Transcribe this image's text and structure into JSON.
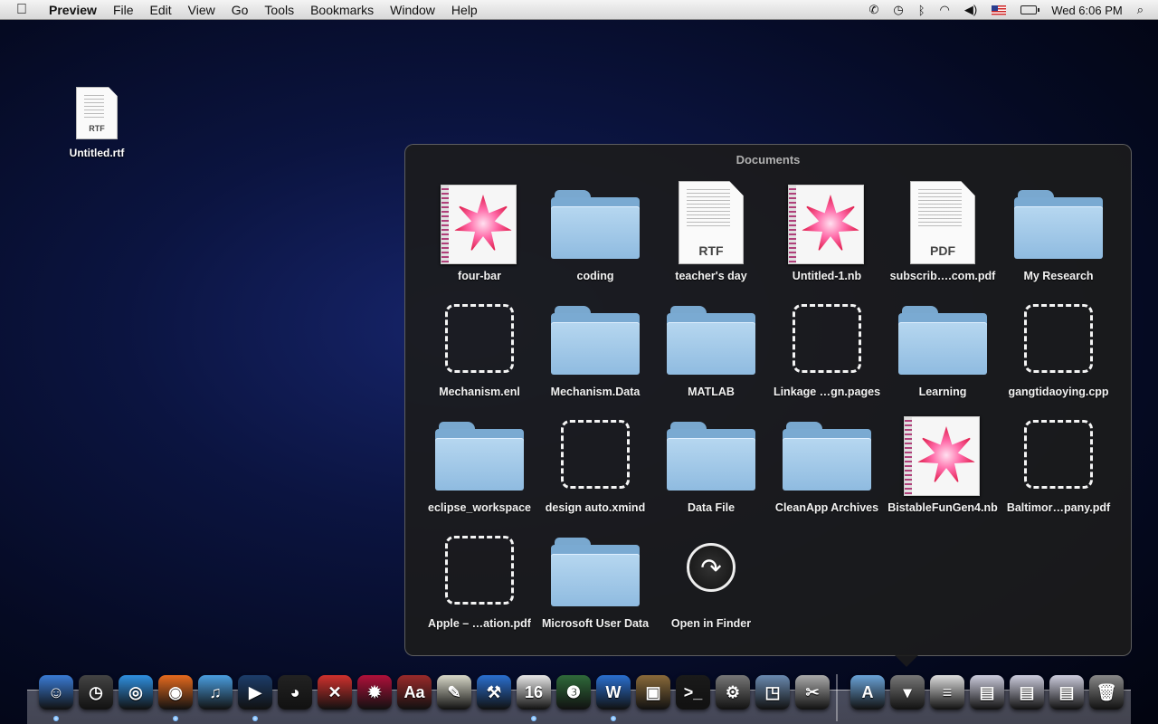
{
  "menubar": {
    "app_name": "Preview",
    "menus": [
      "File",
      "Edit",
      "View",
      "Go",
      "Tools",
      "Bookmarks",
      "Window",
      "Help"
    ],
    "clock": "Wed 6:06 PM"
  },
  "desktop": {
    "icons": [
      {
        "label": "Untitled.rtf",
        "ext": "RTF"
      }
    ]
  },
  "stack": {
    "title": "Documents",
    "items": [
      {
        "label": "four-bar",
        "kind": "notebook"
      },
      {
        "label": "coding",
        "kind": "folder"
      },
      {
        "label": "teacher's day",
        "kind": "document",
        "ext": "RTF"
      },
      {
        "label": "Untitled-1.nb",
        "kind": "notebook"
      },
      {
        "label": "subscrib….com.pdf",
        "kind": "document",
        "ext": "PDF"
      },
      {
        "label": "My Research",
        "kind": "folder"
      },
      {
        "label": "Mechanism.enl",
        "kind": "placeholder"
      },
      {
        "label": "Mechanism.Data",
        "kind": "folder"
      },
      {
        "label": "MATLAB",
        "kind": "folder"
      },
      {
        "label": "Linkage …gn.pages",
        "kind": "placeholder"
      },
      {
        "label": "Learning",
        "kind": "folder"
      },
      {
        "label": "gangtidaoying.cpp",
        "kind": "placeholder"
      },
      {
        "label": "eclipse_workspace",
        "kind": "folder"
      },
      {
        "label": "design auto.xmind",
        "kind": "placeholder"
      },
      {
        "label": "Data File",
        "kind": "folder"
      },
      {
        "label": "CleanApp Archives",
        "kind": "folder"
      },
      {
        "label": "BistableFunGen4.nb",
        "kind": "notebook"
      },
      {
        "label": "Baltimor…pany.pdf",
        "kind": "placeholder"
      },
      {
        "label": "Apple – …ation.pdf",
        "kind": "placeholder"
      },
      {
        "label": "Microsoft User Data",
        "kind": "folder"
      },
      {
        "label": "Open in Finder",
        "kind": "open-finder"
      }
    ]
  },
  "dock": {
    "apps": [
      {
        "name": "finder-icon",
        "glyph": "☺",
        "color": "#3a7bd5"
      },
      {
        "name": "dashboard-icon",
        "glyph": "◷",
        "color": "#444"
      },
      {
        "name": "safari-icon",
        "glyph": "◎",
        "color": "#2f8fe0"
      },
      {
        "name": "firefox-icon",
        "glyph": "◉",
        "color": "#e66a1e"
      },
      {
        "name": "itunes-icon",
        "glyph": "♫",
        "color": "#4a9ee0"
      },
      {
        "name": "quicktime-icon",
        "glyph": "▶",
        "color": "#1c3d6a"
      },
      {
        "name": "qq-icon",
        "glyph": "◕",
        "color": "#222"
      },
      {
        "name": "xmind-icon",
        "glyph": "✕",
        "color": "#d0312d"
      },
      {
        "name": "mathematica-icon",
        "glyph": "✹",
        "color": "#b0103a"
      },
      {
        "name": "dictionary-icon",
        "glyph": "Aa",
        "color": "#9a2a2a"
      },
      {
        "name": "textedit-icon",
        "glyph": "✎",
        "color": "#d8d8c8"
      },
      {
        "name": "xcode-icon",
        "glyph": "⚒",
        "color": "#2a6fd0"
      },
      {
        "name": "ical-icon",
        "glyph": "16",
        "color": "#e8e8e8"
      },
      {
        "name": "matlab-icon",
        "glyph": "❸",
        "color": "#2f6a3a"
      },
      {
        "name": "word-icon",
        "glyph": "W",
        "color": "#2a6fd0"
      },
      {
        "name": "iphoto-icon",
        "glyph": "▣",
        "color": "#8a6a3a"
      },
      {
        "name": "terminal-icon",
        "glyph": ">_",
        "color": "#1a1a1a"
      },
      {
        "name": "system-preferences-icon",
        "glyph": "⚙",
        "color": "#777"
      },
      {
        "name": "preview-icon",
        "glyph": "◳",
        "color": "#6a8ab0"
      },
      {
        "name": "grab-icon",
        "glyph": "✂",
        "color": "#aaa"
      }
    ],
    "stacks": [
      {
        "name": "applications-stack-icon",
        "glyph": "A",
        "color": "#6aa3d8"
      },
      {
        "name": "documents-stack-icon",
        "glyph": "▾",
        "color": "#777"
      },
      {
        "name": "downloads-stack-icon",
        "glyph": "≡",
        "color": "#ddd"
      },
      {
        "name": "minimized-window-1-icon",
        "glyph": "▤",
        "color": "#ccd"
      },
      {
        "name": "minimized-window-2-icon",
        "glyph": "▤",
        "color": "#ccd"
      },
      {
        "name": "minimized-window-3-icon",
        "glyph": "▤",
        "color": "#ccd"
      },
      {
        "name": "trash-icon",
        "glyph": "🗑",
        "color": "#888"
      }
    ]
  }
}
